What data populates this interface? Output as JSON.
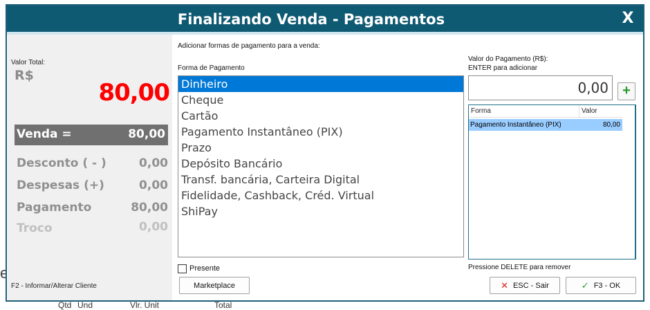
{
  "background": {
    "partial_letter": "e",
    "footer_columns": [
      "Qtd",
      "Und",
      "Vlr. Unit",
      "Total"
    ]
  },
  "dialog": {
    "title": "Finalizando Venda - Pagamentos",
    "close_label": "X"
  },
  "summary": {
    "valor_total_label": "Valor Total:",
    "currency": "R$",
    "total": "80,00",
    "rows": [
      {
        "label": "Venda =",
        "value": "80,00"
      },
      {
        "label": "Desconto ( - )",
        "value": "0,00"
      },
      {
        "label": "Despesas (+)",
        "value": "0,00"
      },
      {
        "label": "Pagamento",
        "value": "80,00"
      },
      {
        "label": "Troco",
        "value": "0,00"
      }
    ],
    "footer_hint": "F2 - Informar/Alterar Cliente"
  },
  "payment": {
    "instruction": "Adicionar formas de pagamento para a venda:",
    "method_label": "Forma de Pagamento",
    "methods": [
      "Dinheiro",
      "Cheque",
      "Cartão",
      "Pagamento Instantâneo (PIX)",
      "Prazo",
      "Depósito Bancário",
      "Transf. bancária, Carteira Digital",
      "Fidelidade, Cashback, Créd. Virtual",
      "ShiPay"
    ],
    "selected_method": "Dinheiro",
    "presente_label": "Presente",
    "marketplace_label": "Marketplace"
  },
  "value_entry": {
    "label_line1": "Valor do Pagamento (R$):",
    "label_line2": "ENTER para adicionar",
    "value": "0,00",
    "add_symbol": "+"
  },
  "payments_grid": {
    "columns": [
      "Forma",
      "Valor"
    ],
    "rows": [
      {
        "forma": "Pagamento Instantâneo (PIX)",
        "valor": "80,00"
      }
    ],
    "delete_hint": "Pressione DELETE para remover"
  },
  "actions": {
    "cancel_label": "ESC - Sair",
    "ok_label": "F3 - OK"
  },
  "colors": {
    "title_bar": "#0f5a73",
    "total_red": "#ff0000",
    "selection_blue": "#0078d7",
    "grid_row": "#99ccff",
    "add_green": "#2b9a2b",
    "cancel_red": "#e02020",
    "ok_green": "#2b9a2b"
  }
}
